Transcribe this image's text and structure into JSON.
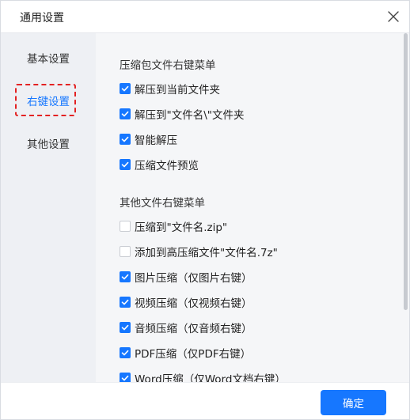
{
  "window": {
    "title": "通用设置"
  },
  "sidebar": {
    "items": [
      {
        "label": "基本设置"
      },
      {
        "label": "右键设置"
      },
      {
        "label": "其他设置"
      }
    ]
  },
  "sections": {
    "archive": {
      "title": "压缩包文件右键菜单",
      "options": [
        {
          "label": "解压到当前文件夹",
          "checked": true
        },
        {
          "label": "解压到\"文件名\\\"文件夹",
          "checked": true
        },
        {
          "label": "智能解压",
          "checked": true
        },
        {
          "label": "压缩文件预览",
          "checked": true
        }
      ]
    },
    "other": {
      "title": "其他文件右键菜单",
      "options": [
        {
          "label": "压缩到\"文件名.zip\"",
          "checked": false
        },
        {
          "label": "添加到高压缩文件\"文件名.7z\"",
          "checked": false
        },
        {
          "label": "图片压缩（仅图片右键）",
          "checked": true
        },
        {
          "label": "视频压缩（仅视频右键）",
          "checked": true
        },
        {
          "label": "音频压缩（仅音频右键）",
          "checked": true
        },
        {
          "label": "PDF压缩（仅PDF右键）",
          "checked": true
        },
        {
          "label": "Word压缩（仅Word文档右键）",
          "checked": true
        }
      ]
    }
  },
  "footer": {
    "confirm_label": "确定"
  },
  "colors": {
    "accent": "#1677ff",
    "highlight_border": "#e32222",
    "sidebar_bg": "#eef0f4",
    "content_bg": "#f5f6f8"
  }
}
